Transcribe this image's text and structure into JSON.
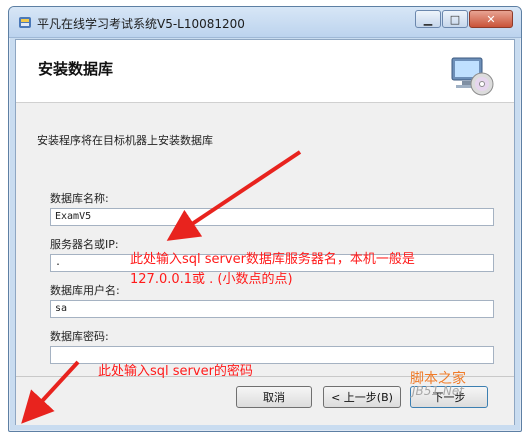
{
  "window": {
    "title": "平凡在线学习考试系统V5-L10081200"
  },
  "header": {
    "heading": "安装数据库"
  },
  "description": "安装程序将在目标机器上安装数据库",
  "fields": [
    {
      "label": "数据库名称:",
      "value": "ExamV5"
    },
    {
      "label": "服务器名或IP:",
      "value": "."
    },
    {
      "label": "数据库用户名:",
      "value": "sa"
    },
    {
      "label": "数据库密码:",
      "value": ""
    }
  ],
  "buttons": {
    "cancel": "取消",
    "prev": "< 上一步(B)",
    "next": "下一步"
  },
  "annotations": {
    "server_line1": "此处输入sql server数据库服务器名，本机一般是",
    "server_line2": "127.0.0.1或 . (小数点的点)",
    "password": "此处输入sql server的密码",
    "color": "#ff1a1a"
  },
  "watermark": {
    "line1": "脚本之家",
    "line2": "JB51.Net"
  },
  "icons": {
    "app": "app-shield-icon",
    "setup": "computer-cd-icon"
  }
}
